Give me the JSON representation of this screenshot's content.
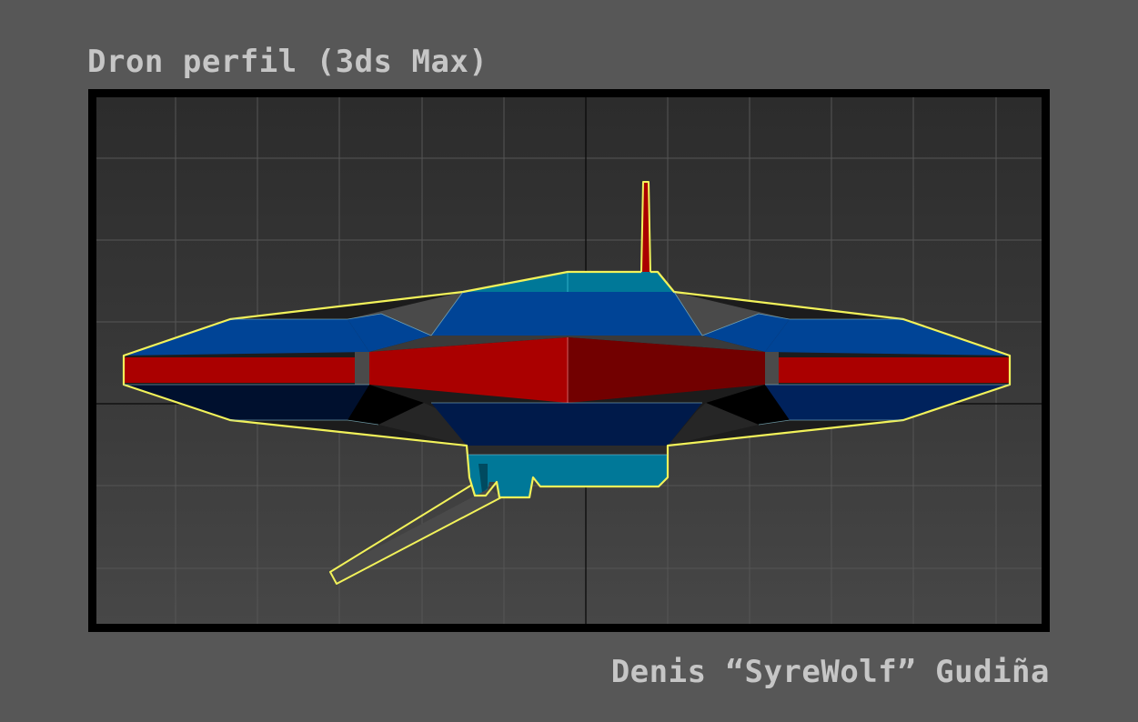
{
  "title": "Dron perfil (3ds Max)",
  "author": "Denis “SyreWolf” Gudiña",
  "viewport": {
    "view": "side profile",
    "colors": {
      "background_top": "#2c2c2c",
      "background_bottom": "#474747",
      "grid": "#555555",
      "axis": "#0a0a0a",
      "selection_outline": "#f2f25a",
      "red": "#aa0000",
      "dark_red": "#720000",
      "blue": "#004496",
      "navy": "#001a4a",
      "teal": "#007898"
    }
  }
}
